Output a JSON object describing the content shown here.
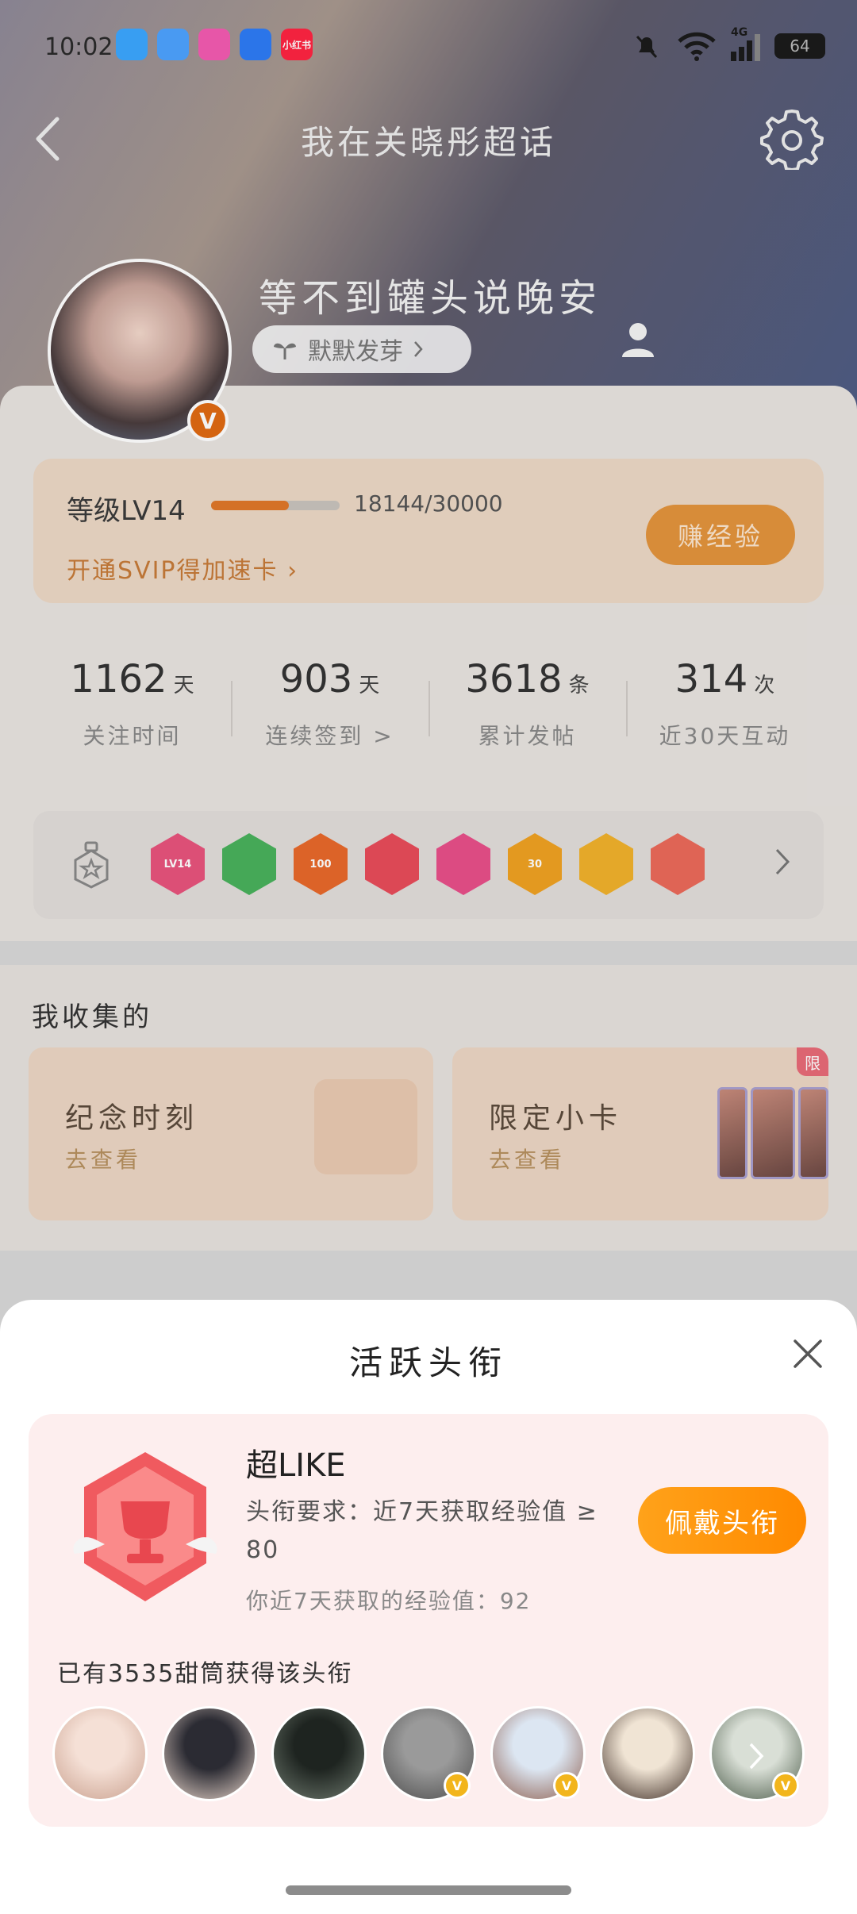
{
  "status_bar": {
    "time": "10:02",
    "network": "4G",
    "battery": "64",
    "app_icons": [
      {
        "name": "video-app-icon",
        "color": "#3ca7ff",
        "text": ""
      },
      {
        "name": "weather-app-icon",
        "color": "#4da3ff",
        "text": ""
      },
      {
        "name": "gallery-app-icon",
        "color": "#f45bb2",
        "text": ""
      },
      {
        "name": "files-app-icon",
        "color": "#2e7cf6",
        "text": ""
      },
      {
        "name": "xiaohongshu-app-icon",
        "color": "#ff2442",
        "text": "小红书"
      }
    ]
  },
  "header": {
    "title": "我在关晓彤超话"
  },
  "profile": {
    "username": "等不到罐头说晚安",
    "status_pill": "默默发芽",
    "verified_mark": "V"
  },
  "level": {
    "label": "等级LV14",
    "progress_value": "18144/30000",
    "progress_fraction": 0.6048,
    "svip_link": "开通SVIP得加速卡",
    "earn_button": "赚经验"
  },
  "stats": [
    {
      "number": "1162",
      "unit": "天",
      "label": "关注时间"
    },
    {
      "number": "903",
      "unit": "天",
      "label": "连续签到 >"
    },
    {
      "number": "3618",
      "unit": "条",
      "label": "累计发帖"
    },
    {
      "number": "314",
      "unit": "次",
      "label": "近30天互动"
    }
  ],
  "badges": [
    {
      "name": "lv14-badge",
      "color": "#e8547d",
      "text": "LV14"
    },
    {
      "name": "gesture-badge",
      "color": "#49b25c",
      "text": ""
    },
    {
      "name": "100-days-badge",
      "color": "#e8692b",
      "text": "100"
    },
    {
      "name": "trophy-badge",
      "color": "#e84c5a",
      "text": ""
    },
    {
      "name": "book-badge",
      "color": "#e8508a",
      "text": ""
    },
    {
      "name": "30-days-badge",
      "color": "#f0a222",
      "text": "30"
    },
    {
      "name": "star-face-badge",
      "color": "#f1b22c",
      "text": ""
    },
    {
      "name": "heart-badge",
      "color": "#eb6a5a",
      "text": ""
    }
  ],
  "collection": {
    "title": "我收集的",
    "cards": [
      {
        "title": "纪念时刻",
        "subtitle": "去查看"
      },
      {
        "title": "限定小卡",
        "subtitle": "去查看",
        "tag": "限"
      }
    ]
  },
  "sheet": {
    "title": "活跃头衔",
    "badge_name": "超LIKE",
    "requirement": "头衔要求：近7天获取经验值 ≥ 80",
    "progress": "你近7天获取的经验值：92",
    "wear_button": "佩戴头衔",
    "owners_text": "已有3535甜筒获得该头衔",
    "owners": [
      {
        "color_a": "#f5e0d6",
        "color_b": "#c9a08e",
        "verified": false
      },
      {
        "color_a": "#2b2b33",
        "color_b": "#e9d6cb",
        "verified": false
      },
      {
        "color_a": "#1e2420",
        "color_b": "#6f7a6f",
        "verified": false
      },
      {
        "color_a": "#9a9a9a",
        "color_b": "#4c4c4c",
        "verified": true
      },
      {
        "color_a": "#dce6f2",
        "color_b": "#8d5d4d",
        "verified": true
      },
      {
        "color_a": "#f0e4d4",
        "color_b": "#3b2a22",
        "verified": false
      },
      {
        "color_a": "#d9dfd6",
        "color_b": "#4a5a48",
        "verified": true
      }
    ],
    "verified_mark": "V"
  },
  "colors": {
    "accent_orange": "#ff8a00",
    "badge_red": "#e8474f"
  }
}
